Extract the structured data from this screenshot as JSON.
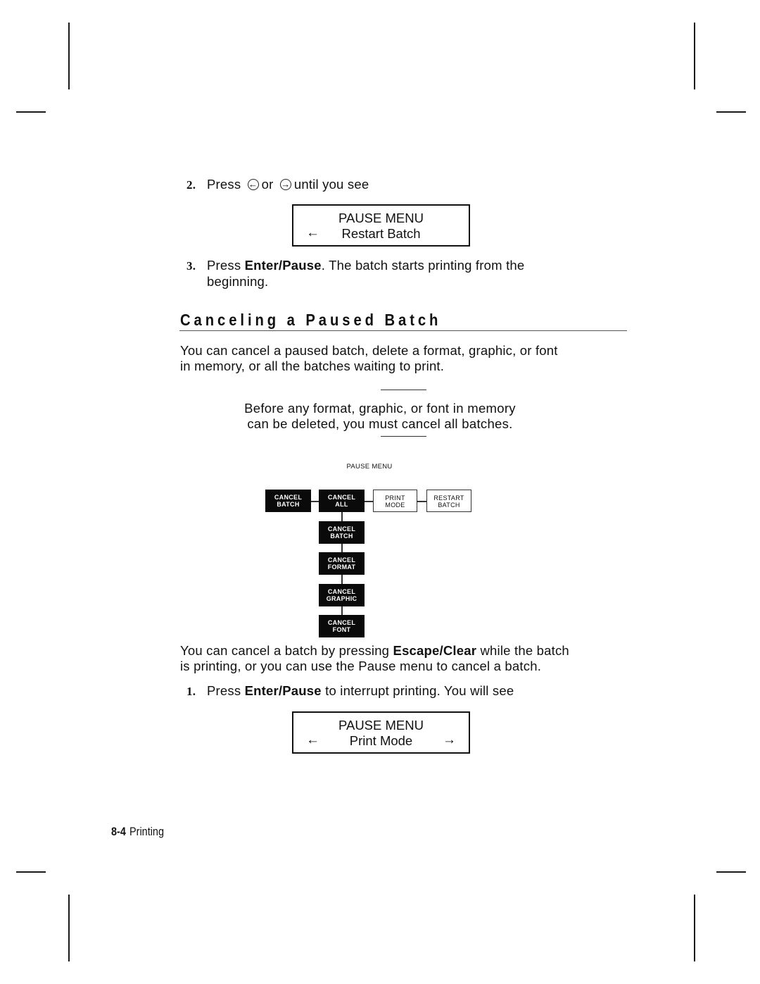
{
  "page": {
    "step2": {
      "number": "2.",
      "prefix": "Press",
      "left_key_icon": "left-arrow-key-icon",
      "connector": "or",
      "right_key_icon": "right-arrow-key-icon",
      "suffix": "until you see"
    },
    "lcd_restart": {
      "line1": "PAUSE MENU",
      "line2": "Restart Batch",
      "left_arrow": "←"
    },
    "step3": {
      "number": "3.",
      "prefix": "Press",
      "key": "Enter/Pause",
      "text_line1": ".  The batch starts printing from the",
      "text_line2": "beginning."
    },
    "section_heading": "Canceling a Paused Batch",
    "intro": {
      "line1": "You can cancel a paused batch, delete a format, graphic, or font",
      "line2": "in memory, or all the batches waiting to print."
    },
    "note": {
      "line1": "Before any format, graphic, or font in memory",
      "line2": "can be deleted, you must cancel all batches."
    },
    "diagram": {
      "title": "PAUSE MENU",
      "top_row": [
        {
          "line1": "CANCEL",
          "line2": "BATCH",
          "style": "dark"
        },
        {
          "line1": "CANCEL",
          "line2": "ALL",
          "style": "dark"
        },
        {
          "line1": "PRINT",
          "line2": "MODE",
          "style": "light"
        },
        {
          "line1": "RESTART",
          "line2": "BATCH",
          "style": "light"
        }
      ],
      "submenu": [
        {
          "line1": "CANCEL",
          "line2": "BATCH"
        },
        {
          "line1": "CANCEL",
          "line2": "FORMAT"
        },
        {
          "line1": "CANCEL",
          "line2": "GRAPHIC"
        },
        {
          "line1": "CANCEL",
          "line2": "FONT"
        }
      ]
    },
    "cancel_para": {
      "prefix": "You can cancel a batch by pressing",
      "key": "Escape/Clear",
      "suffix": "while the batch",
      "line2": "is printing, or you can use the Pause menu to cancel a batch."
    },
    "step1": {
      "number": "1.",
      "prefix": "Press",
      "key": "Enter/Pause",
      "suffix": "to interrupt printing.  You will see"
    },
    "lcd_print_mode": {
      "line1": "PAUSE MENU",
      "line2": "Print Mode",
      "left_arrow": "←",
      "right_arrow": "→"
    },
    "footer": {
      "page_number": "8-4",
      "section": "Printing"
    }
  }
}
